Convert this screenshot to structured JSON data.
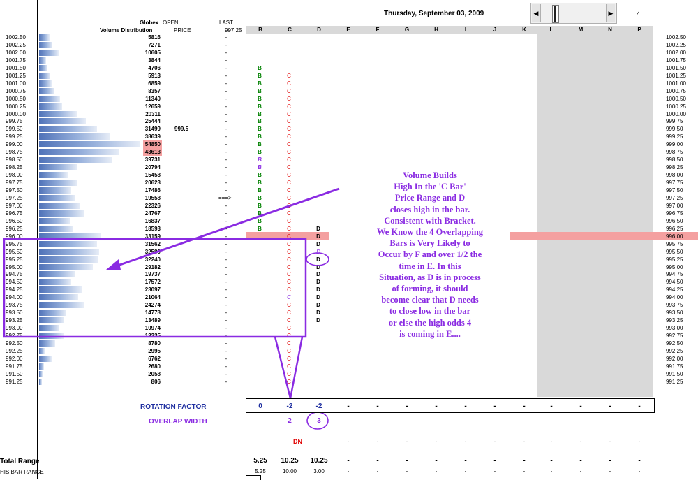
{
  "header": {
    "date": "Thursday, September 03, 2009",
    "globex": "Globex",
    "open_label": "OPEN",
    "vol_dist": "Volume Distribution",
    "price_label": "PRICE",
    "last_label": "LAST",
    "last_value": "997.25",
    "scroll_value": "4",
    "columns": [
      "B",
      "C",
      "D",
      "E",
      "F",
      "G",
      "H",
      "I",
      "J",
      "K",
      "L",
      "M",
      "N",
      "P"
    ]
  },
  "open_price": "999.5",
  "arrow_marker": "===>",
  "rows": [
    {
      "p": "1002.50",
      "v": "5816",
      "b": "",
      "c": "",
      "d": ""
    },
    {
      "p": "1002.25",
      "v": "7271",
      "b": "",
      "c": "",
      "d": ""
    },
    {
      "p": "1002.00",
      "v": "10605",
      "b": "",
      "c": "",
      "d": ""
    },
    {
      "p": "1001.75",
      "v": "3844",
      "b": "",
      "c": "",
      "d": ""
    },
    {
      "p": "1001.50",
      "v": "4706",
      "b": "B",
      "c": "",
      "d": ""
    },
    {
      "p": "1001.25",
      "v": "5913",
      "b": "B",
      "c": "C",
      "d": ""
    },
    {
      "p": "1001.00",
      "v": "6859",
      "b": "B",
      "c": "C",
      "d": ""
    },
    {
      "p": "1000.75",
      "v": "8357",
      "b": "B",
      "c": "C",
      "d": ""
    },
    {
      "p": "1000.50",
      "v": "11340",
      "b": "B",
      "c": "C",
      "d": ""
    },
    {
      "p": "1000.25",
      "v": "12659",
      "b": "B",
      "c": "C",
      "d": ""
    },
    {
      "p": "1000.00",
      "v": "20311",
      "b": "B",
      "c": "C",
      "d": ""
    },
    {
      "p": "999.75",
      "v": "25444",
      "b": "B",
      "c": "C",
      "d": ""
    },
    {
      "p": "999.50",
      "v": "31499",
      "b": "B",
      "c": "C",
      "d": ""
    },
    {
      "p": "999.25",
      "v": "38639",
      "b": "B",
      "c": "C",
      "d": ""
    },
    {
      "p": "999.00",
      "v": "54850",
      "b": "B",
      "c": "C",
      "d": ""
    },
    {
      "p": "998.75",
      "v": "43613",
      "b": "B",
      "c": "C",
      "d": ""
    },
    {
      "p": "998.50",
      "v": "39731",
      "b": "B",
      "c": "C",
      "d": ""
    },
    {
      "p": "998.25",
      "v": "20794",
      "b": "B",
      "c": "C",
      "d": ""
    },
    {
      "p": "998.00",
      "v": "15458",
      "b": "B",
      "c": "C",
      "d": ""
    },
    {
      "p": "997.75",
      "v": "20623",
      "b": "B",
      "c": "C",
      "d": ""
    },
    {
      "p": "997.50",
      "v": "17486",
      "b": "B",
      "c": "C",
      "d": ""
    },
    {
      "p": "997.25",
      "v": "19558",
      "b": "B",
      "c": "C",
      "d": ""
    },
    {
      "p": "997.00",
      "v": "22326",
      "b": "B",
      "c": "C",
      "d": ""
    },
    {
      "p": "996.75",
      "v": "24767",
      "b": "B",
      "c": "C",
      "d": ""
    },
    {
      "p": "996.50",
      "v": "16837",
      "b": "B",
      "c": "C",
      "d": ""
    },
    {
      "p": "996.25",
      "v": "18593",
      "b": "B",
      "c": "C",
      "d": "D"
    },
    {
      "p": "996.00",
      "v": "33159",
      "b": "",
      "c": "C",
      "d": "D"
    },
    {
      "p": "995.75",
      "v": "31562",
      "b": "",
      "c": "C",
      "d": "D"
    },
    {
      "p": "995.50",
      "v": "32599",
      "b": "",
      "c": "C",
      "d": "D"
    },
    {
      "p": "995.25",
      "v": "32240",
      "b": "",
      "c": "C",
      "d": "D"
    },
    {
      "p": "995.00",
      "v": "29182",
      "b": "",
      "c": "C",
      "d": "D"
    },
    {
      "p": "994.75",
      "v": "19737",
      "b": "",
      "c": "C",
      "d": "D"
    },
    {
      "p": "994.50",
      "v": "17572",
      "b": "",
      "c": "C",
      "d": "D"
    },
    {
      "p": "994.25",
      "v": "23097",
      "b": "",
      "c": "C",
      "d": "D"
    },
    {
      "p": "994.00",
      "v": "21064",
      "b": "",
      "c": "C",
      "d": "D"
    },
    {
      "p": "993.75",
      "v": "24274",
      "b": "",
      "c": "C",
      "d": "D"
    },
    {
      "p": "993.50",
      "v": "14778",
      "b": "",
      "c": "C",
      "d": "D"
    },
    {
      "p": "993.25",
      "v": "13489",
      "b": "",
      "c": "C",
      "d": "D"
    },
    {
      "p": "993.00",
      "v": "10974",
      "b": "",
      "c": "C",
      "d": ""
    },
    {
      "p": "992.75",
      "v": "13335",
      "b": "",
      "c": "C",
      "d": ""
    },
    {
      "p": "992.50",
      "v": "8780",
      "b": "",
      "c": "C",
      "d": ""
    },
    {
      "p": "992.25",
      "v": "2995",
      "b": "",
      "c": "C",
      "d": ""
    },
    {
      "p": "992.00",
      "v": "6762",
      "b": "",
      "c": "C",
      "d": ""
    },
    {
      "p": "991.75",
      "v": "2680",
      "b": "",
      "c": "C",
      "d": ""
    },
    {
      "p": "991.50",
      "v": "2058",
      "b": "",
      "c": "C",
      "d": ""
    },
    {
      "p": "991.25",
      "v": "806",
      "b": "",
      "c": "C",
      "d": ""
    }
  ],
  "annotation": [
    "Volume Builds",
    "High In the 'C Bar'",
    "Price Range and D",
    "closes high in the bar.",
    "Consistent with Bracket.",
    "We Know the 4 Overlapping",
    "Bars is Very Likely to",
    "Occur by F and over 1/2 the",
    "time in E.  In this",
    "Situation, as D is in process",
    "of forming, it should",
    "become clear that D needs",
    "to close low in the bar",
    "or else the high odds 4",
    "is coming in E...."
  ],
  "rotation": {
    "label": "ROTATION FACTOR",
    "values": [
      "0",
      "-2",
      "-2",
      "-",
      "-",
      "-",
      "-",
      "-",
      "-",
      "-",
      "-",
      "-",
      "-",
      "-"
    ]
  },
  "overlap": {
    "label": "OVERLAP WIDTH",
    "values": [
      "",
      "2",
      "3"
    ]
  },
  "dn": {
    "label": "DN",
    "values": [
      "-",
      "-",
      "-",
      "-",
      "-",
      "-",
      "-",
      "-",
      "-",
      "-",
      "-"
    ]
  },
  "total_range": {
    "label": "Total Range",
    "values": [
      "5.25",
      "10.25",
      "10.25",
      "-",
      "-",
      "-",
      "-",
      "-",
      "-",
      "-",
      "-",
      "-",
      "-",
      "-"
    ]
  },
  "this_bar": {
    "label": "HIS BAR RANGE",
    "values": [
      "5.25",
      "10.00",
      "3.00",
      "-",
      "-",
      "-",
      "-",
      "-",
      "-",
      "-",
      "-",
      "-",
      "-",
      "-"
    ]
  },
  "colors": {
    "accent": "#8a2be2",
    "tpoB": "#008000",
    "tpoC": "#e00000",
    "highlight": "#f4a0a0",
    "grey": "#d9d9d9"
  }
}
